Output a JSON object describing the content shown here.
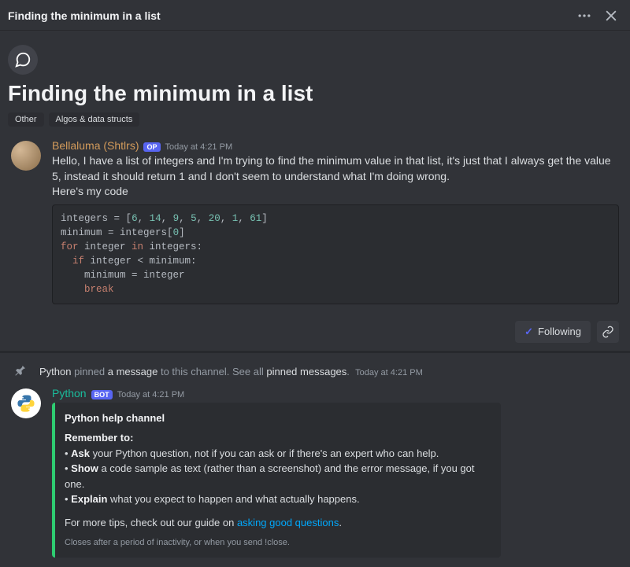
{
  "header": {
    "title": "Finding the minimum in a list"
  },
  "thread": {
    "title": "Finding the minimum in a list",
    "tags": [
      "Other",
      "Algos & data structs"
    ]
  },
  "op": {
    "author": "Bellaluma (Shtlrs)",
    "badge": "OP",
    "timestamp": "Today at 4:21 PM",
    "text_line1": "Hello, I have a list of integers and I'm trying to find the minimum value in that list, it's just that I always get the value 5, instead it should return 1 and I don't seem to understand what I'm doing wrong.",
    "text_line2": "Here's my code",
    "code": {
      "integers": [
        6,
        14,
        9,
        5,
        20,
        1,
        61
      ]
    }
  },
  "actions": {
    "following": "Following"
  },
  "pin": {
    "actor": "Python",
    "mid1": " pinned ",
    "bold1": "a message",
    "mid2": " to this channel. See all ",
    "bold2": "pinned messages",
    "tail": ".",
    "timestamp": "Today at 4:21 PM"
  },
  "bot": {
    "author": "Python",
    "badge": "BOT",
    "timestamp": "Today at 4:21 PM",
    "embed": {
      "title": "Python help channel",
      "remember": "Remember to:",
      "b1a": "Ask",
      "b1b": " your Python question, not if you can ask or if there's an expert who can help.",
      "b2a": "Show",
      "b2b": " a code sample as text (rather than a screenshot) and the error message, if you got one.",
      "b3a": "Explain",
      "b3b": " what you expect to happen and what actually happens.",
      "tips_pre": "For more tips, check out our guide on ",
      "tips_link": "asking good questions",
      "tips_post": ".",
      "footer": "Closes after a period of inactivity, or when you send !close."
    }
  }
}
